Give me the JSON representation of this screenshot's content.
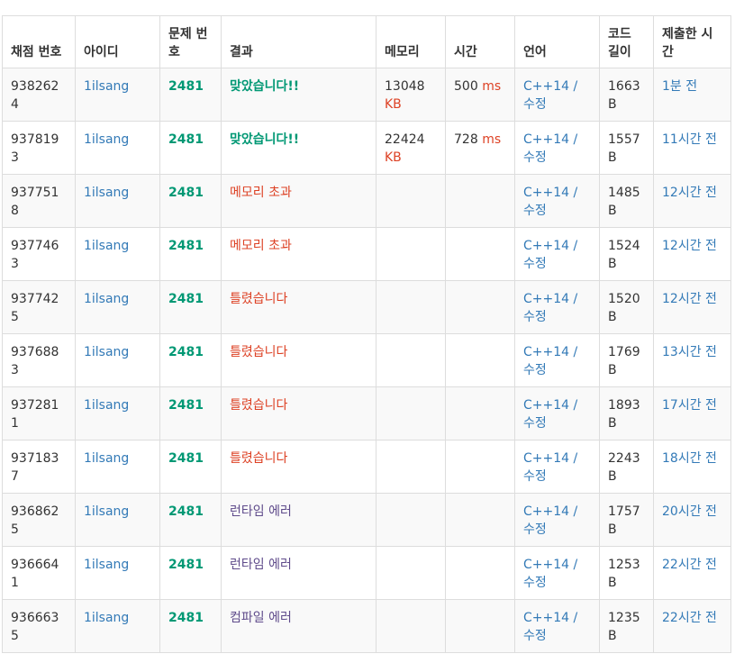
{
  "headers": [
    "채점 번호",
    "아이디",
    "문제 번호",
    "결과",
    "메모리",
    "시간",
    "언어",
    "코드 길이",
    "제출한 시간"
  ],
  "units": {
    "memory": "KB",
    "time": "ms",
    "code": "B"
  },
  "colors": {
    "link": "#337ab7",
    "accepted": "#009874",
    "wrong": "#dd4124",
    "runtime": "#5f4b8b",
    "stripe": "#f9f9f9",
    "border": "#dddddd"
  },
  "rows": [
    {
      "id": "9382624",
      "user": "1ilsang",
      "problem": "2481",
      "result": "맞았습니다!!",
      "result_type": "ac",
      "memory": "13048",
      "time": "500",
      "lang": "C++14 / 수정",
      "code": "1663",
      "ago": "1분 전"
    },
    {
      "id": "9378193",
      "user": "1ilsang",
      "problem": "2481",
      "result": "맞았습니다!!",
      "result_type": "ac",
      "memory": "22424",
      "time": "728",
      "lang": "C++14 / 수정",
      "code": "1557",
      "ago": "11시간 전"
    },
    {
      "id": "9377518",
      "user": "1ilsang",
      "problem": "2481",
      "result": "메모리 초과",
      "result_type": "err",
      "memory": "",
      "time": "",
      "lang": "C++14 / 수정",
      "code": "1485",
      "ago": "12시간 전"
    },
    {
      "id": "9377463",
      "user": "1ilsang",
      "problem": "2481",
      "result": "메모리 초과",
      "result_type": "err",
      "memory": "",
      "time": "",
      "lang": "C++14 / 수정",
      "code": "1524",
      "ago": "12시간 전"
    },
    {
      "id": "9377425",
      "user": "1ilsang",
      "problem": "2481",
      "result": "틀렸습니다",
      "result_type": "err",
      "memory": "",
      "time": "",
      "lang": "C++14 / 수정",
      "code": "1520",
      "ago": "12시간 전"
    },
    {
      "id": "9376883",
      "user": "1ilsang",
      "problem": "2481",
      "result": "틀렸습니다",
      "result_type": "err",
      "memory": "",
      "time": "",
      "lang": "C++14 / 수정",
      "code": "1769",
      "ago": "13시간 전"
    },
    {
      "id": "9372811",
      "user": "1ilsang",
      "problem": "2481",
      "result": "틀렸습니다",
      "result_type": "err",
      "memory": "",
      "time": "",
      "lang": "C++14 / 수정",
      "code": "1893",
      "ago": "17시간 전"
    },
    {
      "id": "9371837",
      "user": "1ilsang",
      "problem": "2481",
      "result": "틀렸습니다",
      "result_type": "err",
      "memory": "",
      "time": "",
      "lang": "C++14 / 수정",
      "code": "2243",
      "ago": "18시간 전"
    },
    {
      "id": "9368625",
      "user": "1ilsang",
      "problem": "2481",
      "result": "런타임 에러",
      "result_type": "rte",
      "memory": "",
      "time": "",
      "lang": "C++14 / 수정",
      "code": "1757",
      "ago": "20시간 전"
    },
    {
      "id": "9366641",
      "user": "1ilsang",
      "problem": "2481",
      "result": "런타임 에러",
      "result_type": "rte",
      "memory": "",
      "time": "",
      "lang": "C++14 / 수정",
      "code": "1253",
      "ago": "22시간 전"
    },
    {
      "id": "9366635",
      "user": "1ilsang",
      "problem": "2481",
      "result": "컴파일 에러",
      "result_type": "rte",
      "memory": "",
      "time": "",
      "lang": "C++14 / 수정",
      "code": "1235",
      "ago": "22시간 전"
    }
  ]
}
